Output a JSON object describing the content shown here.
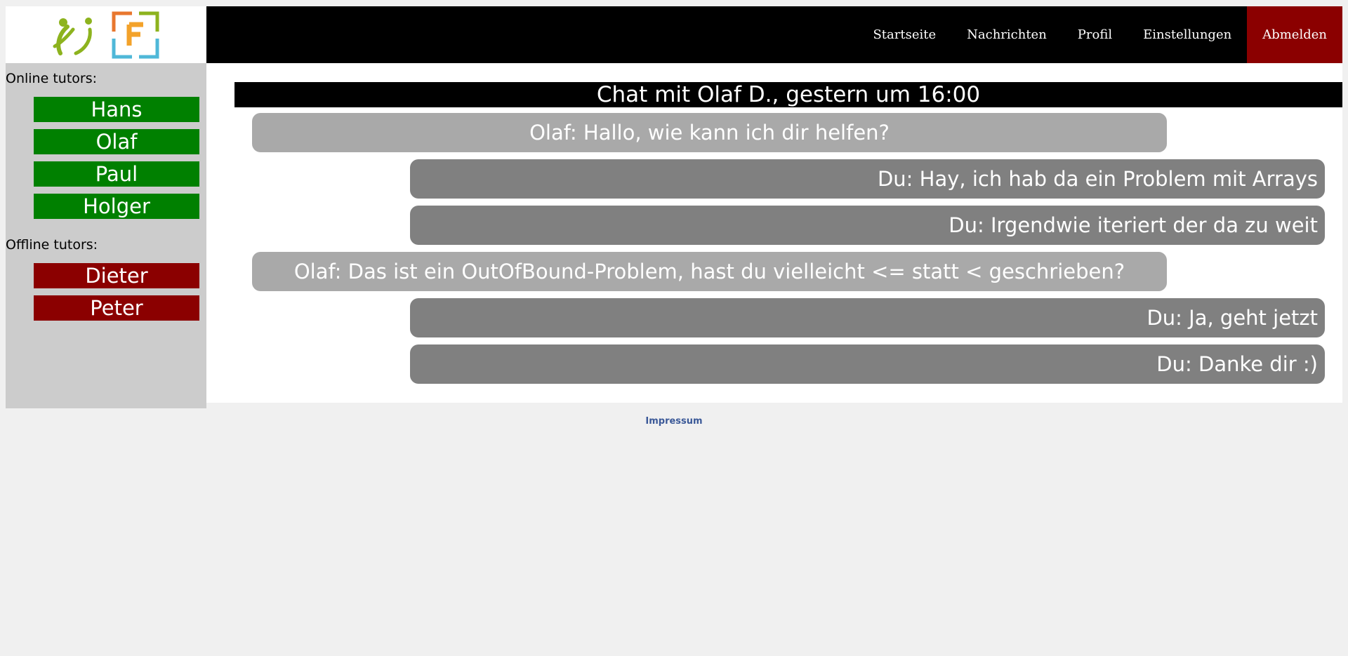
{
  "nav": {
    "items": [
      {
        "label": "Startseite"
      },
      {
        "label": "Nachrichten"
      },
      {
        "label": "Profil"
      },
      {
        "label": "Einstellungen"
      },
      {
        "label": "Abmelden"
      }
    ]
  },
  "sidebar": {
    "online_label": "Online tutors:",
    "offline_label": "Offline tutors:",
    "online": [
      {
        "name": "Hans"
      },
      {
        "name": "Olaf"
      },
      {
        "name": "Paul"
      },
      {
        "name": "Holger"
      }
    ],
    "offline": [
      {
        "name": "Dieter"
      },
      {
        "name": "Peter"
      }
    ]
  },
  "chat": {
    "title": "Chat mit Olaf D., gestern um 16:00",
    "messages": [
      {
        "from": "other",
        "text": "Olaf: Hallo, wie kann ich dir helfen?"
      },
      {
        "from": "self",
        "text": "Du: Hay, ich hab da ein Problem mit Arrays"
      },
      {
        "from": "self",
        "text": "Du: Irgendwie iteriert der da zu weit"
      },
      {
        "from": "other",
        "text": "Olaf: Das ist ein OutOfBound-Problem, hast du vielleicht <= statt < geschrieben?"
      },
      {
        "from": "self",
        "text": "Du: Ja, geht jetzt"
      },
      {
        "from": "self",
        "text": "Du: Danke dir :)"
      }
    ]
  },
  "footer": {
    "link": "Impressum"
  },
  "colors": {
    "online": "#008000",
    "offline": "#8b0000",
    "logout": "#8b0000",
    "bubble_other": "#a9a9a9",
    "bubble_self": "#808080"
  },
  "icons": {
    "logo_left": "people-figure-logo",
    "logo_right": "letter-f-frame-logo"
  }
}
